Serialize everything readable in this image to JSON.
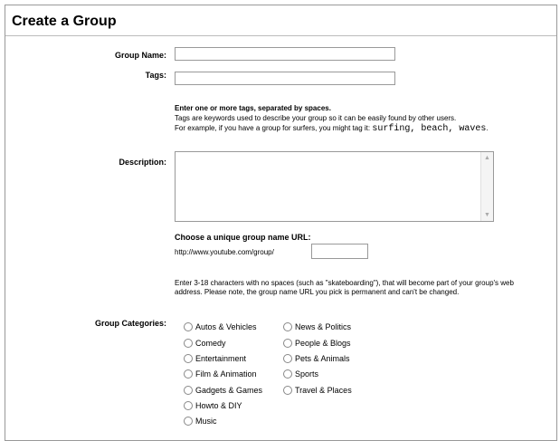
{
  "title": "Create a Group",
  "fields": {
    "group_name_label": "Group Name:",
    "group_name_value": "",
    "tags_label": "Tags:",
    "tags_value": "",
    "description_label": "Description:",
    "description_value": "",
    "categories_label": "Group Categories:"
  },
  "tags_help": {
    "heading": "Enter one or more tags, separated by spaces.",
    "line1": "Tags are keywords used to describe your group so it can be easily found by other users.",
    "line2_prefix": "For example, if you have a group for surfers, you might tag it:",
    "example_tags": "surfing, beach, waves",
    "line2_suffix": "."
  },
  "url": {
    "heading": "Choose a unique group name URL:",
    "prefix": "http://www.youtube.com/group/",
    "value": "",
    "help": "Enter 3-18 characters with no spaces (such as \"skateboarding\"), that will become part of your group's web address. Please note, the group name URL you pick is permanent and can't be changed."
  },
  "categories": {
    "left": [
      "Autos & Vehicles",
      "Comedy",
      "Entertainment",
      "Film & Animation",
      "Gadgets & Games",
      "Howto & DIY",
      "Music"
    ],
    "right": [
      "News & Politics",
      "People & Blogs",
      "Pets & Animals",
      "Sports",
      "Travel & Places"
    ]
  }
}
